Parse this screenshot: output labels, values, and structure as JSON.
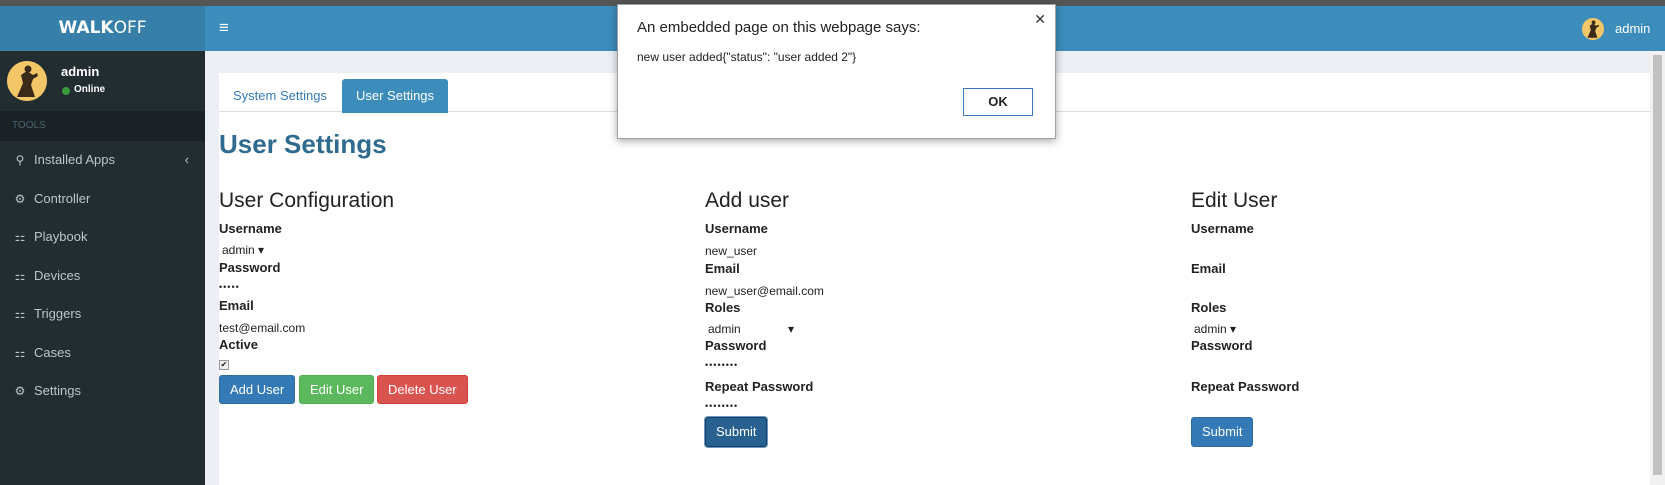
{
  "app": {
    "logo_bold": "WALK",
    "logo_light": "OFF"
  },
  "sidebar": {
    "username": "admin",
    "status": "Online",
    "section": "TOOLS",
    "items": [
      {
        "label": "Installed Apps",
        "icon": "link-icon",
        "glyph": "⚲",
        "chevron": "‹"
      },
      {
        "label": "Controller",
        "icon": "gear-icon",
        "glyph": "⚙"
      },
      {
        "label": "Playbook",
        "icon": "sitemap-icon",
        "glyph": "⚏"
      },
      {
        "label": "Devices",
        "icon": "sitemap-icon",
        "glyph": "⚏"
      },
      {
        "label": "Triggers",
        "icon": "sitemap-icon",
        "glyph": "⚏"
      },
      {
        "label": "Cases",
        "icon": "sitemap-icon",
        "glyph": "⚏"
      },
      {
        "label": "Settings",
        "icon": "gear-icon",
        "glyph": "⚙"
      }
    ]
  },
  "header": {
    "menu_glyph": "≡",
    "username": "admin"
  },
  "tabs": {
    "system": "System Settings",
    "user": "User Settings"
  },
  "page_title": "User Settings",
  "user_config": {
    "title": "User Configuration",
    "username_label": "Username",
    "username_value": "admin ▾",
    "password_label": "Password",
    "password_value": "•••••",
    "email_label": "Email",
    "email_value": "test@email.com",
    "active_label": "Active",
    "active_checked": "✔",
    "add_button": "Add User",
    "edit_button": "Edit User",
    "delete_button": "Delete User"
  },
  "add_user": {
    "title": "Add user",
    "username_label": "Username",
    "username_value": "new_user",
    "email_label": "Email",
    "email_value": "new_user@email.com",
    "roles_label": "Roles",
    "roles_value": "admin",
    "roles_arrow": "▾",
    "password_label": "Password",
    "password_value": "••••••••",
    "repeat_label": "Repeat Password",
    "repeat_value": "••••••••",
    "submit": "Submit"
  },
  "edit_user": {
    "title": "Edit User",
    "username_label": "Username",
    "email_label": "Email",
    "roles_label": "Roles",
    "roles_value": "admin ▾",
    "password_label": "Password",
    "repeat_label": "Repeat Password",
    "submit": "Submit"
  },
  "dialog": {
    "title": "An embedded page on this webpage says:",
    "message": "new user added{\"status\": \"user added 2\"}",
    "ok": "OK",
    "close_glyph": "✕"
  },
  "colors": {
    "header": "#3c8dbc",
    "sidebar": "#222d32",
    "primary": "#337ab7",
    "success": "#5cb85c",
    "danger": "#d9534f"
  }
}
